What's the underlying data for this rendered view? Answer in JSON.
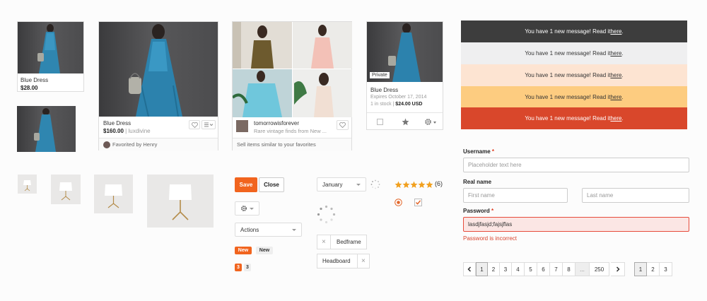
{
  "product_small": {
    "title": "Blue Dress",
    "price": "$28.00"
  },
  "product_large": {
    "title": "Blue Dress",
    "price": "$160.00",
    "shop": "luxdivine",
    "favorited": "Favorited by Henry"
  },
  "shop_card": {
    "name": "tomorrowisforever",
    "desc": "Rare vintage finds from New ...",
    "footer": "Sell items similar to your favorites"
  },
  "private_card": {
    "badge": "Private",
    "title": "Blue Dress",
    "expires": "Expires October 17, 2014",
    "stock": "1 in stock",
    "price": "$24.00 USD"
  },
  "buttons": {
    "save": "Save",
    "close": "Close"
  },
  "actions_select": {
    "value": "Actions"
  },
  "month_select": {
    "value": "January"
  },
  "badges": {
    "new_orange": "New",
    "new_gray": "New",
    "count_orange": "3",
    "count_gray": "3"
  },
  "tags": {
    "bedframe": "Bedframe",
    "headboard": "Headboard",
    "remove": "×"
  },
  "rating": {
    "stars": 5,
    "count": "(6)"
  },
  "alerts": {
    "text": "You have 1 new message! Read it ",
    "link": "here",
    "end": ".",
    "colors": [
      "#3d3d3d",
      "#efeff0",
      "#fde4d2",
      "#fdcc80",
      "#d9472b"
    ]
  },
  "form": {
    "username_label": "Username",
    "username_placeholder": "Placeholder text here",
    "realname_label": "Real name",
    "first_placeholder": "First name",
    "last_placeholder": "Last name",
    "password_label": "Password",
    "password_value": "lasdjfasjd;fajsjflas",
    "password_error": "Password is incorrect",
    "required_mark": "*"
  },
  "pagination": {
    "prev": "‹",
    "next": "›",
    "pages": [
      "1",
      "2",
      "3",
      "4",
      "5",
      "6",
      "7",
      "8",
      "...",
      "250"
    ],
    "short_pages": [
      "1",
      "2",
      "3"
    ]
  }
}
